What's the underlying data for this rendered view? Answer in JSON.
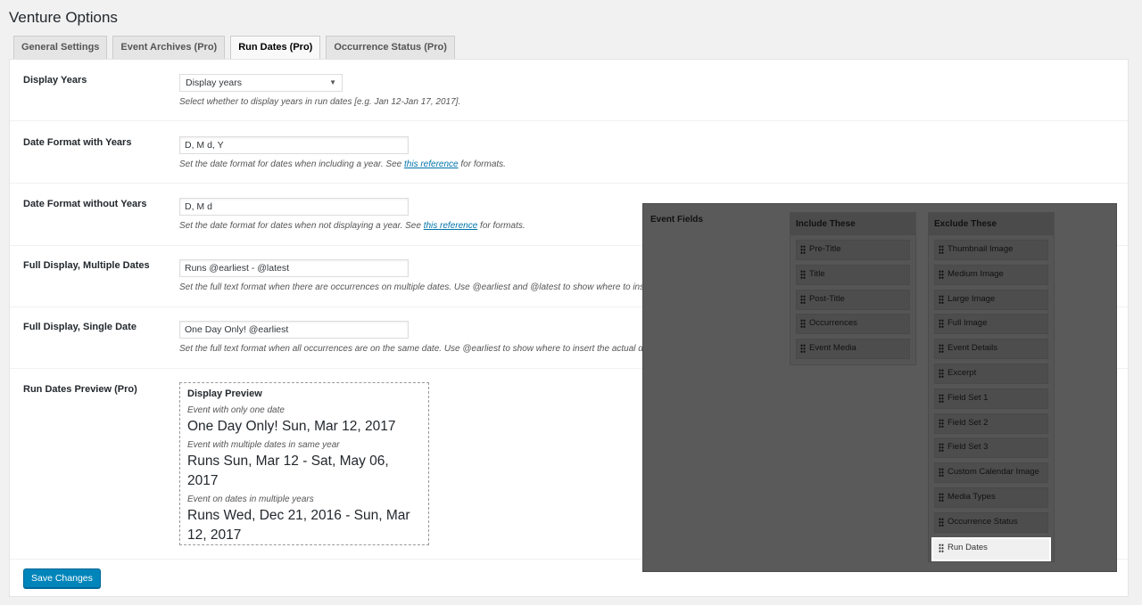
{
  "page": {
    "title": "Venture Options"
  },
  "tabs": [
    {
      "label": "General Settings"
    },
    {
      "label": "Event Archives (Pro)"
    },
    {
      "label": "Run Dates (Pro)"
    },
    {
      "label": "Occurrence Status (Pro)"
    }
  ],
  "active_tab": "Run Dates (Pro)",
  "settings": {
    "display_years": {
      "label": "Display Years",
      "value": "Display years",
      "description": "Select whether to display years in run dates [e.g. Jan 12-Jan 17, 2017]."
    },
    "date_format_years": {
      "label": "Date Format with Years",
      "value": "D, M d, Y",
      "desc_before": "Set the date format for dates when including a year. See ",
      "link": "this reference",
      "desc_after": " for formats."
    },
    "date_format_no_years": {
      "label": "Date Format without Years",
      "value": "D, M d",
      "desc_before": "Set the date format for dates when not displaying a year. See ",
      "link": "this reference",
      "desc_after": " for formats."
    },
    "full_multiple": {
      "label": "Full Display, Multiple Dates",
      "value": "Runs @earliest - @latest",
      "description": "Set the full text format when there are occurrences on multiple dates. Use @earliest and @latest to show where to inse"
    },
    "full_single": {
      "label": "Full Display, Single Date",
      "value": "One Day Only! @earliest",
      "description": "Set the full text format when all occurrences are on the same date. Use @earliest to show where to insert the actual da"
    },
    "preview": {
      "label": "Run Dates Preview (Pro)",
      "title": "Display Preview",
      "items": [
        {
          "caption": "Event with only one date",
          "value": "One Day Only! Sun, Mar 12, 2017"
        },
        {
          "caption": "Event with multiple dates in same year",
          "value": "Runs Sun, Mar 12 - Sat, May 06, 2017"
        },
        {
          "caption": "Event on dates in multiple years",
          "value": "Runs Wed, Dec 21, 2016 - Sun, Mar 12, 2017"
        }
      ]
    }
  },
  "save_button": "Save Changes",
  "event_fields": {
    "label": "Event Fields",
    "include": {
      "title": "Include These",
      "items": [
        "Pre-Title",
        "Title",
        "Post-Title",
        "Occurrences",
        "Event Media"
      ]
    },
    "exclude": {
      "title": "Exclude These",
      "items": [
        "Thumbnail Image",
        "Medium Image",
        "Large Image",
        "Full Image",
        "Event Details",
        "Excerpt",
        "Field Set 1",
        "Field Set 2",
        "Field Set 3",
        "Custom Calendar Image",
        "Media Types",
        "Occurrence Status",
        "Run Dates"
      ]
    }
  },
  "colors": {
    "accent": "#0085ba",
    "link": "#0073aa",
    "overlay": "#5a5a5a"
  }
}
